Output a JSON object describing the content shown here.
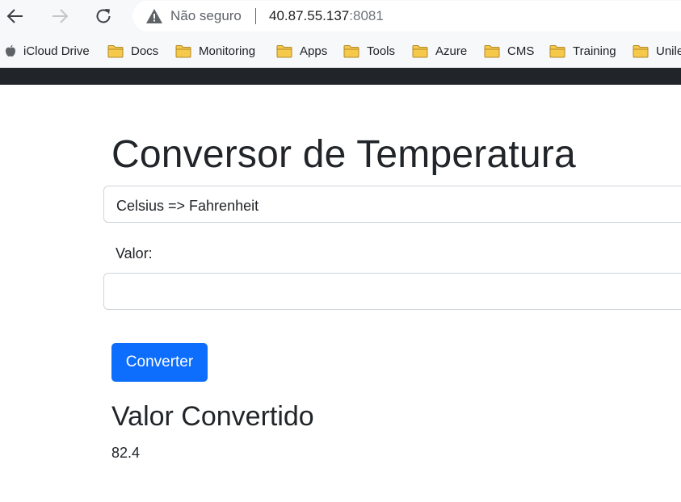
{
  "browser": {
    "security_label": "Não seguro",
    "url_host": "40.87.55.137",
    "url_port": ":8081"
  },
  "bookmarks": [
    {
      "label": "iCloud Drive",
      "icon": "apple-icon"
    },
    {
      "label": "Docs",
      "icon": "folder-icon"
    },
    {
      "label": "Monitoring",
      "icon": "folder-icon"
    },
    {
      "label": "Apps",
      "icon": "folder-icon"
    },
    {
      "label": "Tools",
      "icon": "folder-icon"
    },
    {
      "label": "Azure",
      "icon": "folder-icon"
    },
    {
      "label": "CMS",
      "icon": "folder-icon"
    },
    {
      "label": "Training",
      "icon": "folder-icon"
    },
    {
      "label": "Unile",
      "icon": "folder-icon"
    }
  ],
  "page": {
    "title": "Conversor de Temperatura",
    "conversion_select": {
      "selected": "Celsius => Fahrenheit"
    },
    "value_label": "Valor:",
    "value_input": {
      "value": "",
      "placeholder": ""
    },
    "convert_button": "Converter",
    "result_title": "Valor Convertido",
    "result_value": "82.4"
  },
  "colors": {
    "primary": "#0d6efd",
    "navbar": "#212529",
    "text": "#212529",
    "border": "#ced4da",
    "folder": "#f6c94a"
  }
}
